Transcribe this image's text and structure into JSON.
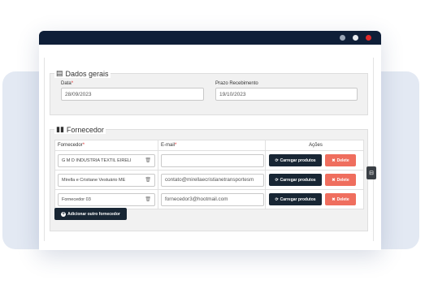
{
  "dados_gerais": {
    "legend": "Dados gerais",
    "data_label": "Data",
    "data_value": "28/09/2023",
    "prazo_label": "Prazo Recebimento",
    "prazo_value": "19/10/2023"
  },
  "fornecedor": {
    "legend": "Fornecedor",
    "columns": {
      "fornecedor": "Fornecedor",
      "email": "E-mail",
      "acoes": "Ações"
    },
    "rows": [
      {
        "name": "G M D INDUSTRIA TEXTIL EIRELI",
        "email": ""
      },
      {
        "name": "Mirella e Cristiane Vestuário ME",
        "email": "contato@mirellaecristianetransportesm"
      },
      {
        "name": "Fornecedor 03",
        "email": "fornecedor3@hootmail.com"
      }
    ],
    "load_label": "Carregar produtos",
    "delete_label": "Delete",
    "add_label": "Adicionar outro fornecedor"
  },
  "colors": {
    "titlebar": "#0f1f38",
    "dark_button": "#182634",
    "delete_button": "#ef6e5e",
    "required": "#e02a2a"
  },
  "icons": [
    "calendar-icon",
    "bar-chart-icon",
    "trash-icon",
    "refresh-icon",
    "close-icon",
    "plus-circle-icon",
    "sidebar-toggle-icon"
  ]
}
